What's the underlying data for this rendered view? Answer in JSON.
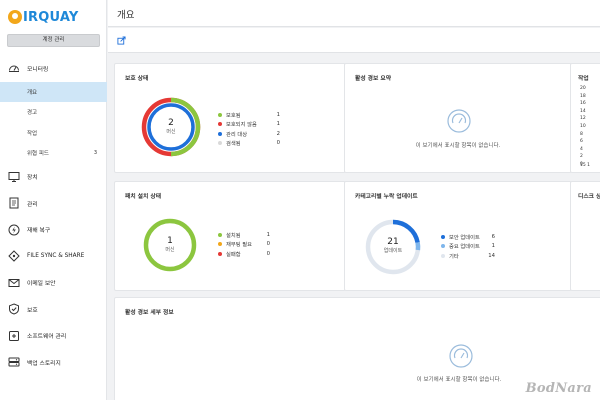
{
  "app": {
    "logo_text": "IRQUAY",
    "account_button": "계정 관리"
  },
  "sidebar": {
    "items": [
      {
        "label": "모니터링",
        "icon": "gauge-icon"
      },
      {
        "label": "장치",
        "icon": "monitor-icon"
      },
      {
        "label": "관리",
        "icon": "document-icon"
      },
      {
        "label": "재해 복구",
        "icon": "lightning-icon"
      },
      {
        "label": "FILE SYNC & SHARE",
        "icon": "sync-icon"
      },
      {
        "label": "이메일 보안",
        "icon": "mail-icon"
      },
      {
        "label": "보호",
        "icon": "shield-icon"
      },
      {
        "label": "소프트웨어 관리",
        "icon": "software-icon"
      },
      {
        "label": "백업 스토리지",
        "icon": "storage-icon"
      }
    ],
    "monitoring_sub": [
      {
        "label": "개요",
        "active": true
      },
      {
        "label": "경고"
      },
      {
        "label": "작업"
      },
      {
        "label": "위협 피드",
        "badge": "3"
      }
    ]
  },
  "header": {
    "title": "개요"
  },
  "cards": {
    "protection": {
      "title": "보호 상태",
      "center_value": "2",
      "center_label": "머신",
      "legend": [
        {
          "label": "보호됨",
          "value": "1",
          "color": "#8cc63f"
        },
        {
          "label": "보호되지 않음",
          "value": "1",
          "color": "#e53935"
        },
        {
          "label": "관리 대상",
          "value": "2",
          "color": "#1e6fd9"
        },
        {
          "label": "검색됨",
          "value": "0",
          "color": "#d9d9d9"
        }
      ]
    },
    "active_alerts": {
      "title": "활성 경보 요약",
      "empty_text": "이 보기에서 표시할 항목이 없습니다."
    },
    "jobs": {
      "title": "작업",
      "axis": [
        "20",
        "18",
        "16",
        "14",
        "12",
        "10",
        "8",
        "6",
        "4",
        "2",
        "0"
      ],
      "x_label": "15 1"
    },
    "patch": {
      "title": "패치 설치 상태",
      "center_value": "1",
      "center_label": "머신",
      "legend": [
        {
          "label": "설치됨",
          "value": "1",
          "color": "#8cc63f"
        },
        {
          "label": "재부팅 필요",
          "value": "0",
          "color": "#f2a71b"
        },
        {
          "label": "실패함",
          "value": "0",
          "color": "#e53935"
        }
      ]
    },
    "missing_updates": {
      "title": "카테고리별 누락 업데이트",
      "center_value": "21",
      "center_label": "업데이트",
      "legend": [
        {
          "label": "보안 업데이트",
          "value": "6",
          "color": "#1e6fd9"
        },
        {
          "label": "중요 업데이트",
          "value": "1",
          "color": "#7fb6ec"
        },
        {
          "label": "기타",
          "value": "14",
          "color": "#e0e6ee"
        }
      ]
    },
    "disk": {
      "title": "디스크 상"
    },
    "alert_details": {
      "title": "활성 경보 세부 정보",
      "empty_text": "이 보기에서 표시할 항목이 없습니다."
    }
  },
  "watermark": "BodNara"
}
